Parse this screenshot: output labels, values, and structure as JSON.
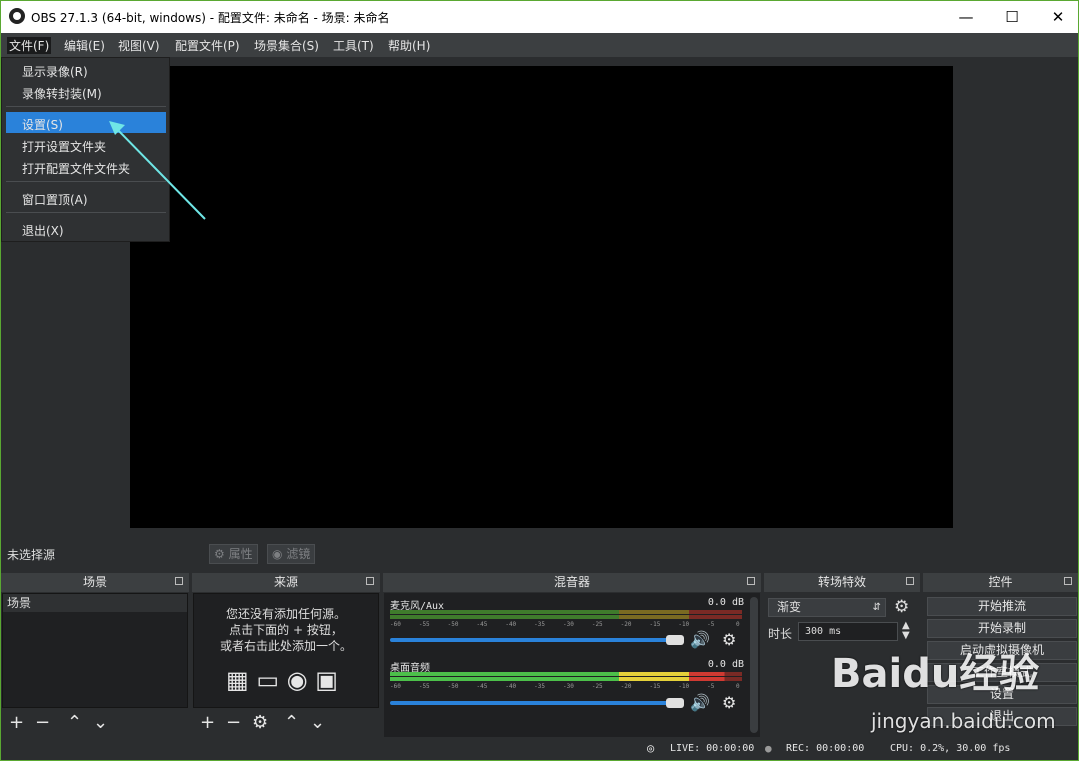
{
  "window": {
    "title": "OBS 27.1.3 (64-bit, windows) - 配置文件: 未命名 - 场景: 未命名"
  },
  "menu": {
    "file": "文件(F)",
    "edit": "编辑(E)",
    "view": "视图(V)",
    "profile": "配置文件(P)",
    "scene_collection": "场景集合(S)",
    "tools": "工具(T)",
    "help": "帮助(H)"
  },
  "file_menu": {
    "show_recordings": "显示录像(R)",
    "remux": "录像转封装(M)",
    "settings": "设置(S)",
    "open_settings_folder": "打开设置文件夹",
    "open_profile_folder": "打开配置文件文件夹",
    "always_on_top": "窗口置顶(A)",
    "exit": "退出(X)"
  },
  "source_toolbar": {
    "no_source": "未选择源",
    "properties": "属性",
    "filters": "滤镜"
  },
  "docks": {
    "scenes": {
      "title": "场景",
      "items": [
        "场景"
      ]
    },
    "sources": {
      "title": "来源",
      "empty_line1": "您还没有添加任何源。",
      "empty_line2": "点击下面的 + 按钮，",
      "empty_line3": "或者右击此处添加一个。"
    },
    "mixer": {
      "title": "混音器",
      "channels": [
        {
          "name": "麦克风/Aux",
          "db": "0.0 dB"
        },
        {
          "name": "桌面音频",
          "db": "0.0 dB"
        }
      ],
      "ticks": [
        "-60",
        "-55",
        "-50",
        "-45",
        "-40",
        "-35",
        "-30",
        "-25",
        "-20",
        "-15",
        "-10",
        "-5",
        "0"
      ]
    },
    "transitions": {
      "title": "转场特效",
      "selected": "渐变",
      "duration_label": "时长",
      "duration_value": "300 ms"
    },
    "controls": {
      "title": "控件",
      "buttons": [
        "开始推流",
        "开始录制",
        "启动虚拟摄像机",
        "工作室模式",
        "设置",
        "退出"
      ]
    }
  },
  "status": {
    "live": "LIVE: 00:00:00",
    "rec": "REC: 00:00:00",
    "cpu": "CPU: 0.2%, 30.00 fps"
  },
  "watermark": {
    "brand": "Baidu经验",
    "url": "jingyan.baidu.com"
  },
  "colors": {
    "highlight": "#2a82da",
    "arrow": "#6fe6e6"
  }
}
